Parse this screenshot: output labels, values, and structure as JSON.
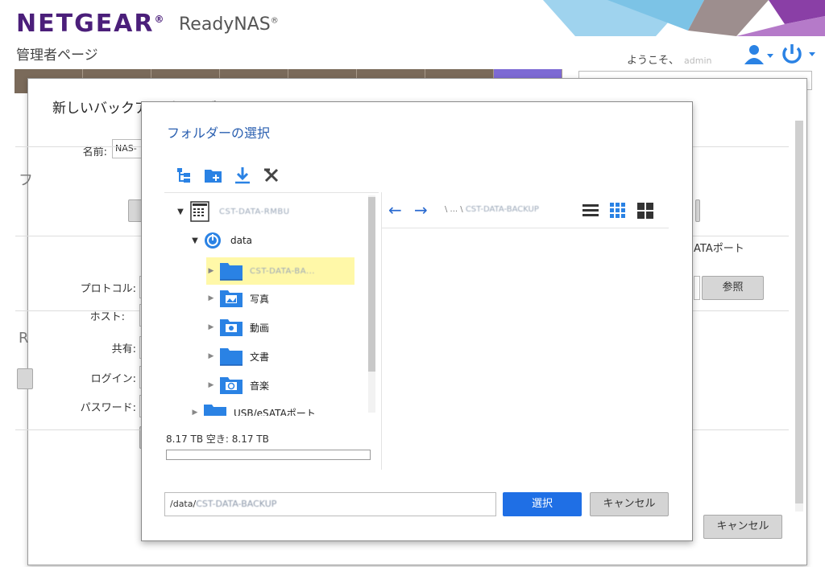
{
  "header": {
    "brand": "NETGEAR",
    "registered": "®",
    "product": "ReadyNAS",
    "admin_page": "管理者ページ",
    "welcome": "ようこそ、",
    "username": "admin"
  },
  "background_dialog": {
    "title": "新しいバックアップジョブ",
    "name_label": "名前:",
    "name_value": "NAS-",
    "usb_esata_fragment": "ATAポート",
    "browse_button": "参照",
    "protocol_label": "プロトコル:",
    "host_label": "ホスト:",
    "share_label": "共有:",
    "login_label": "ログイン:",
    "password_label": "パスワード:",
    "cancel_button": "キャンセル",
    "letter_f": "フ",
    "letter_r": "R"
  },
  "folder_dialog": {
    "title": "フォルダーの選択",
    "toolbar_icons": [
      "folder-tree-icon",
      "new-folder-icon",
      "download-icon",
      "remove-icon"
    ],
    "tree": {
      "root": "CST-DATA-RMBU",
      "volume": "data",
      "folders": [
        {
          "label": "CST-DATA-BA...",
          "icon": "folder-icon",
          "selected": true
        },
        {
          "label": "写真",
          "icon": "photo-folder-icon",
          "selected": false
        },
        {
          "label": "動画",
          "icon": "video-folder-icon",
          "selected": false
        },
        {
          "label": "文書",
          "icon": "document-folder-icon",
          "selected": false
        },
        {
          "label": "音楽",
          "icon": "music-folder-icon",
          "selected": false
        }
      ],
      "usb": "USB/eSATAポート"
    },
    "space_label": "8.17 TB 空き: 8.17 TB",
    "space_used_fraction": 0,
    "path_prefix": "\\ ... \\",
    "path_folder": "CST-DATA-BACKUP",
    "input_prefix": "/data/",
    "input_folder": "CST-DATA-BACKUP",
    "select_button": "選択",
    "cancel_button": "キャンセル"
  },
  "colors": {
    "brand_purple": "#4b1f7a",
    "accent_blue": "#1f6fe5",
    "selected_row": "#fff8a8",
    "nav_active": "#7d6ad4"
  }
}
